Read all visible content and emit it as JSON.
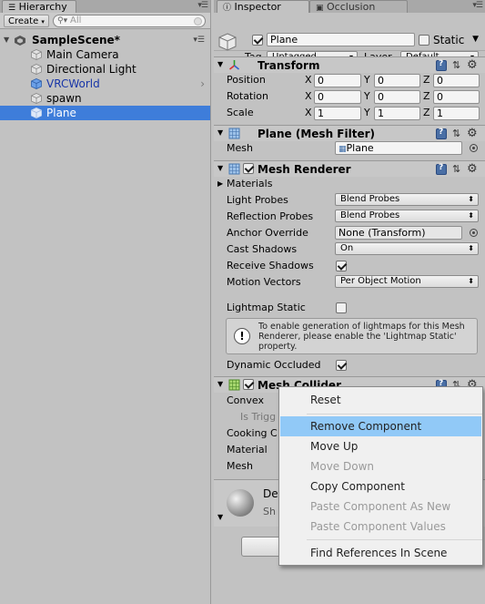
{
  "hierarchy": {
    "tab_label": "Hierarchy",
    "create_label": "Create",
    "search_placeholder": "All",
    "scene_name": "SampleScene*",
    "items": [
      {
        "label": "Main Camera"
      },
      {
        "label": "Directional Light"
      },
      {
        "label": "VRCWorld"
      },
      {
        "label": "spawn"
      },
      {
        "label": "Plane"
      }
    ]
  },
  "inspector": {
    "tabs": [
      {
        "label": "Inspector"
      },
      {
        "label": "Occlusion"
      }
    ],
    "object_name": "Plane",
    "static_label": "Static",
    "tag_label": "Tag",
    "tag_value": "Untagged",
    "layer_label": "Layer",
    "layer_value": "Default"
  },
  "transform": {
    "title": "Transform",
    "rows": [
      {
        "label": "Position",
        "x": "0",
        "y": "0",
        "z": "0"
      },
      {
        "label": "Rotation",
        "x": "0",
        "y": "0",
        "z": "0"
      },
      {
        "label": "Scale",
        "x": "1",
        "y": "1",
        "z": "1"
      }
    ],
    "axis": {
      "x": "X",
      "y": "Y",
      "z": "Z"
    }
  },
  "mesh_filter": {
    "title": "Plane (Mesh Filter)",
    "mesh_label": "Mesh",
    "mesh_value": "Plane"
  },
  "mesh_renderer": {
    "title": "Mesh Renderer",
    "materials_label": "Materials",
    "light_probes_label": "Light Probes",
    "light_probes_value": "Blend Probes",
    "reflection_probes_label": "Reflection Probes",
    "reflection_probes_value": "Blend Probes",
    "anchor_override_label": "Anchor Override",
    "anchor_override_value": "None (Transform)",
    "cast_shadows_label": "Cast Shadows",
    "cast_shadows_value": "On",
    "receive_shadows_label": "Receive Shadows",
    "motion_vectors_label": "Motion Vectors",
    "motion_vectors_value": "Per Object Motion",
    "lightmap_static_label": "Lightmap Static",
    "help_text": "To enable generation of lightmaps for this Mesh Renderer, please enable the 'Lightmap Static' property.",
    "dynamic_occluded_label": "Dynamic Occluded"
  },
  "mesh_collider": {
    "title": "Mesh Collider",
    "convex_label": "Convex",
    "is_trigger_label": "Is Trigg",
    "cooking_label": "Cooking C",
    "material_label": "Material",
    "mesh_label": "Mesh"
  },
  "material_preview": {
    "name_partial": "De",
    "shader_partial": "Sh"
  },
  "context_menu": {
    "items": [
      {
        "label": "Reset",
        "disabled": false
      },
      {
        "label": "Remove Component",
        "disabled": false
      },
      {
        "label": "Move Up",
        "disabled": false
      },
      {
        "label": "Move Down",
        "disabled": true
      },
      {
        "label": "Copy Component",
        "disabled": false
      },
      {
        "label": "Paste Component As New",
        "disabled": true
      },
      {
        "label": "Paste Component Values",
        "disabled": true
      },
      {
        "label": "Find References In Scene",
        "disabled": false
      }
    ],
    "highlight_color": "#91c9f7"
  },
  "colors": {
    "selection": "#3e7dda",
    "prefab_text": "#1936a8",
    "panel_bg": "#c2c2c2"
  }
}
